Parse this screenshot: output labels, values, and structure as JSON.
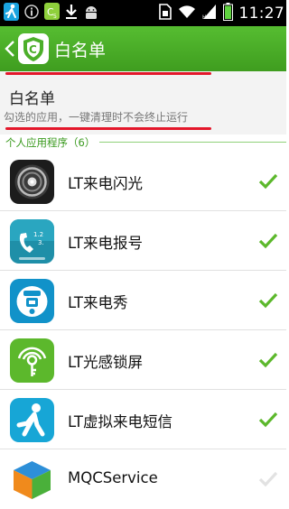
{
  "status_bar": {
    "time": "11:27",
    "icons": [
      "running-man-icon",
      "info-icon",
      "cleanmaster-icon",
      "download-icon",
      "android-icon",
      "sim-icon",
      "wifi-icon",
      "signal-icon",
      "battery-icon"
    ]
  },
  "header": {
    "title": "白名单",
    "back_icon": "chevron-left-icon",
    "logo_icon": "shield-logo-icon",
    "bg_color": "#4caf2a"
  },
  "section": {
    "title": "白名单",
    "description": "勾选的应用，一键清理时不会终止运行",
    "annotation_color": "#e4172b"
  },
  "group": {
    "label": "个人应用程序（6）"
  },
  "apps": [
    {
      "label": "LT来电闪光",
      "icon": "flash-ring-icon",
      "checked": true
    },
    {
      "label": "LT来电报号",
      "icon": "voice-caller-icon",
      "checked": true
    },
    {
      "label": "LT来电秀",
      "icon": "caller-show-icon",
      "checked": true
    },
    {
      "label": "LT光感锁屏",
      "icon": "light-lock-icon",
      "checked": true
    },
    {
      "label": "LT虚拟来电短信",
      "icon": "runner-icon",
      "checked": true
    },
    {
      "label": "MQCService",
      "icon": "cube-icon",
      "checked": false
    }
  ]
}
